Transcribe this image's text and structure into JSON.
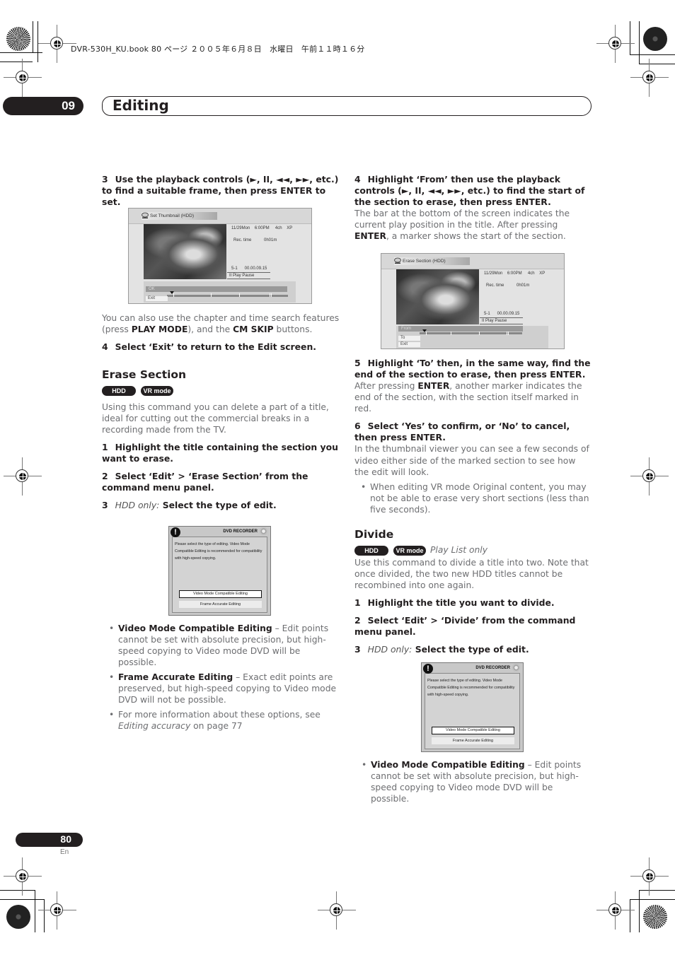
{
  "print_header": "DVR-530H_KU.book  80 ページ  ２００５年６月８日　水曜日　午前１１時１６分",
  "chapter": {
    "number": "09",
    "title": "Editing"
  },
  "left_column": {
    "step3": {
      "num": "3",
      "text": "Use the playback controls (►, II, ◄◄, ►►, etc.) to find a suitable frame, then press ENTER to set."
    },
    "screen1": {
      "title": "Set Thumbnail  (HDD)",
      "date_line": "11/29Mon    6:00PM     4ch    XP",
      "rec_time_label": "Rec. time",
      "rec_time_value": "0h01m",
      "position": "5-1      00.00.09.15",
      "play_state": "II  Play Pause",
      "options": [
        "OK",
        "Exit"
      ]
    },
    "note": {
      "pre": "You can also use the chapter and time search features (press ",
      "b1": "PLAY MODE",
      "mid": "), and the ",
      "b2": "CM SKIP",
      "post": " buttons."
    },
    "step4": {
      "num": "4",
      "text": "Select ‘Exit’ to return to the Edit screen."
    },
    "erase_section": {
      "heading": "Erase Section",
      "badges": [
        "HDD",
        "VR mode"
      ],
      "intro": "Using this command you can delete a part of a title, ideal for cutting out the commercial breaks in a recording made from the TV.",
      "step1": {
        "num": "1",
        "text": "Highlight the title containing the section you want to erase."
      },
      "step2": {
        "num": "2",
        "text": "Select ‘Edit’ > ‘Erase Section’ from the command menu panel."
      },
      "step3": {
        "num": "3",
        "prefix": "HDD only:",
        "text": "Select the type of edit."
      }
    },
    "dialog": {
      "brand": "DVD RECORDER",
      "message": "Please select the type of editing. Video Mode Compatible Editing is recommended for compatibility with high-speed copying.",
      "options": [
        "Video Mode Compatible Editing",
        "Frame Accurate Editing"
      ]
    },
    "bullets": [
      {
        "bold": "Video Mode Compatible Editing",
        "text": " – Edit points cannot be set with absolute precision, but high-speed copying to Video mode DVD will be possible."
      },
      {
        "bold": "Frame Accurate Editing",
        "text": " – Exact edit points are preserved, but high-speed copying to Video mode DVD will not be possible."
      },
      {
        "pre": "For more information about these options, see ",
        "ital": "Editing accuracy",
        "post": " on page 77"
      }
    ]
  },
  "right_column": {
    "step4": {
      "num": "4",
      "text": "Highlight ‘From’ then use the playback controls (►, II, ◄◄, ►►, etc.) to find the start of the section to erase, then press ENTER."
    },
    "step4_body": {
      "pre": "The bar at the bottom of the screen indicates the current play position in the title. After pressing ",
      "b": "ENTER",
      "post": ", a marker shows the start of the section."
    },
    "screen2": {
      "title": "Erase Section  (HDD)",
      "date_line": "11/29Mon    6:00PM     4ch    XP",
      "rec_time_label": "Rec. time",
      "rec_time_value": "0h01m",
      "position": "5-1      00.00.09.15",
      "play_state": "II  Play Pause",
      "options": [
        "From",
        "To",
        "Exit"
      ]
    },
    "step5": {
      "num": "5",
      "text": "Highlight ‘To’ then, in the same way, find the end of the section to erase, then press ENTER."
    },
    "step5_body": {
      "pre": "After pressing ",
      "b": "ENTER",
      "post": ", another marker indicates the end of the section, with the section itself marked in red."
    },
    "step6": {
      "num": "6",
      "text": "Select ‘Yes’ to confirm, or ‘No’ to cancel, then press ENTER."
    },
    "step6_body": "In the thumbnail viewer you can see a few seconds of video either side of the marked section to see how the edit will look.",
    "step6_bullet": "When editing VR mode Original content, you may not be able to erase very short sections (less than five seconds).",
    "divide": {
      "heading": "Divide",
      "badges": [
        "HDD",
        "VR mode"
      ],
      "badge_note": "Play List only",
      "intro": "Use this command to divide a title into two. Note that once divided, the two new HDD titles cannot be recombined into one again.",
      "step1": {
        "num": "1",
        "text": "Highlight the title you want to divide."
      },
      "step2": {
        "num": "2",
        "text": "Select ‘Edit’ > ‘Divide’ from the command menu panel."
      },
      "step3": {
        "num": "3",
        "prefix": "HDD only:",
        "text": "Select the type of edit."
      }
    },
    "dialog": {
      "brand": "DVD RECORDER",
      "message": "Please select the type of editing. Video Mode Compatible Editing is recommended for compatibility with high-speed copying.",
      "options": [
        "Video Mode Compatible Editing",
        "Frame Accurate Editing"
      ]
    },
    "bullets": [
      {
        "bold": "Video Mode Compatible Editing",
        "text": " – Edit points cannot be set with absolute precision, but high-speed copying to Video mode DVD will be possible."
      }
    ]
  },
  "footer": {
    "page_number": "80",
    "language": "En"
  }
}
